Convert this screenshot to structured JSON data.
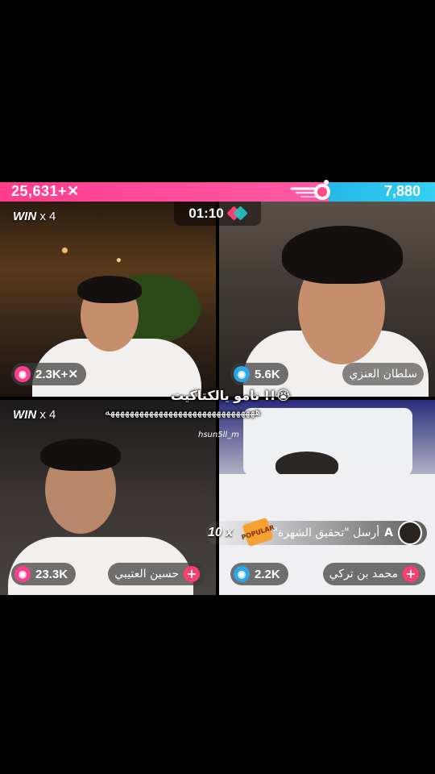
{
  "scorebar": {
    "left_score": "25,631+✕",
    "right_score": "7,880",
    "left_color": "#ff3d8d",
    "right_color": "#26b8e8",
    "center_icon": "battle-comet-icon"
  },
  "timer": {
    "value": "01:10",
    "icon": "diamond-pair-icon"
  },
  "tiles": {
    "top_left": {
      "win_label": "WIN",
      "win_mult": "x 4",
      "points": "2.3K+✕",
      "points_icon": "camera-pink-icon"
    },
    "top_right": {
      "points": "5.6K",
      "points_icon": "camera-blue-icon",
      "name": "سلطان العنزي"
    },
    "bottom_left": {
      "win_label": "WIN",
      "win_mult": "x 4",
      "points": "23.3K",
      "points_icon": "camera-pink-icon",
      "name": "حسين العتيبي"
    },
    "bottom_right": {
      "points": "2.2K",
      "points_icon": "camera-blue-icon",
      "name": "محمد بن تركي"
    }
  },
  "gift": {
    "count": "10 x",
    "badge": "POPULAR",
    "sender_initial": "A",
    "text": "أرسل \"تحقيق الشهرة\""
  },
  "captions": {
    "line1": "نامو يالكتاكيت !!😭",
    "line2": "هههههههههههههههههههههههههههههههه",
    "username": "hsun5ll_m"
  }
}
